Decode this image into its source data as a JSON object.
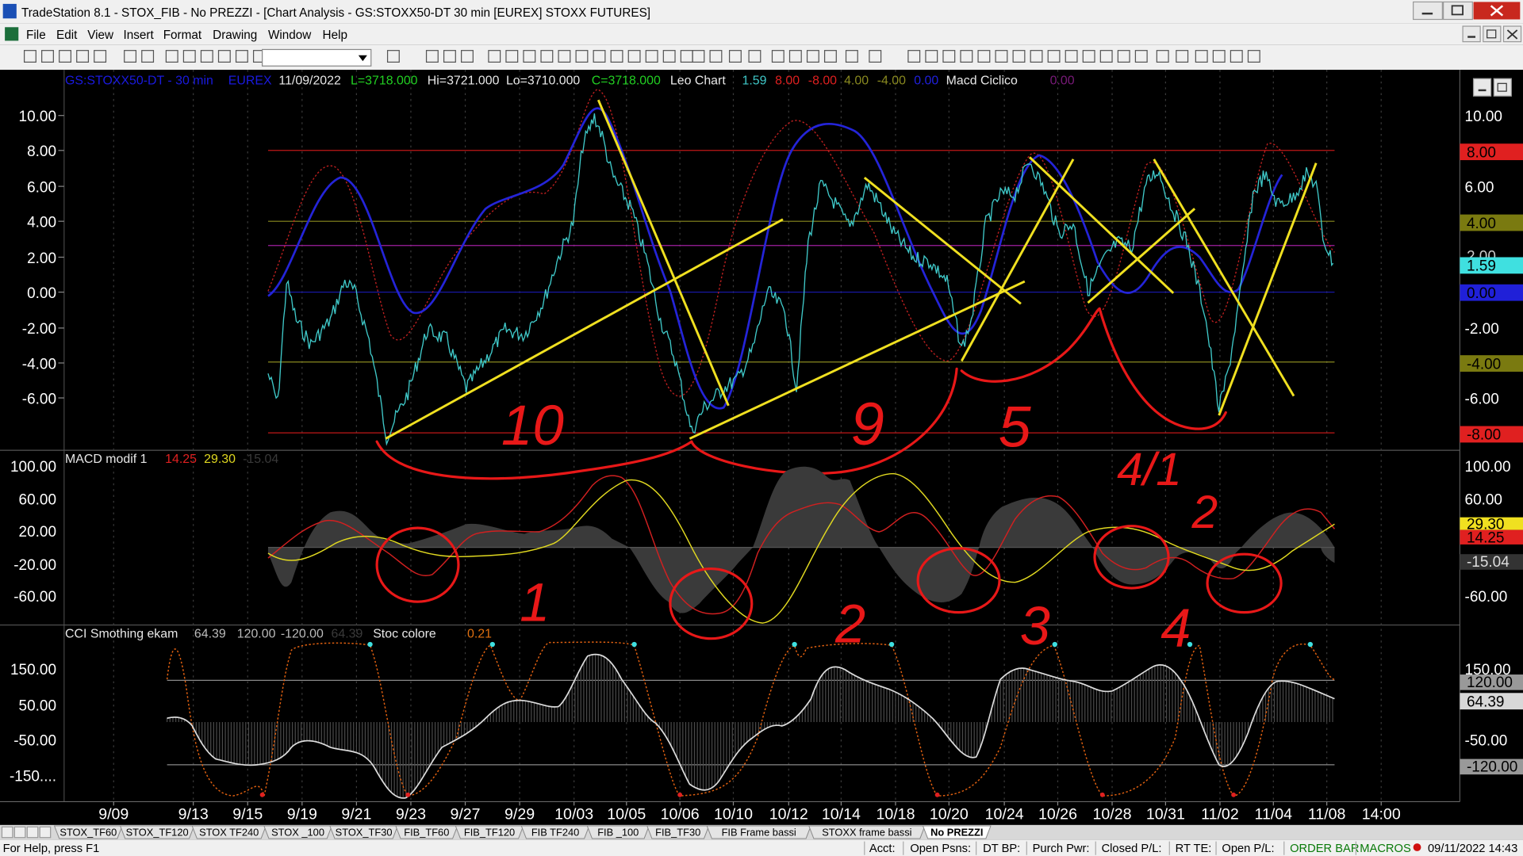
{
  "window": {
    "title": "TradeStation 8.1 - STOX_FIB - No PREZZI - [Chart Analysis - GS:STOXX50-DT  30 min  [EUREX] STOXX FUTURES]",
    "controls": [
      "_",
      "□",
      "×"
    ]
  },
  "menu": [
    "File",
    "Edit",
    "View",
    "Insert",
    "Format",
    "Drawing",
    "Window",
    "Help"
  ],
  "chart": {
    "header": {
      "symbol": "GS:STOXX50-DT - 30 min",
      "exchange": "EUREX",
      "date": "11/09/2022",
      "last": "L=3718.000",
      "high": "Hi=3721.000",
      "low": "Lo=3710.000",
      "close": "C=3718.000",
      "indicator": "Leo Chart",
      "v1": "1.59",
      "v2": "8.00",
      "v3": "-8.00",
      "v4": "4.00",
      "v5": "-4.00",
      "v6": "0.00",
      "indicator2": "Macd Ciclico",
      "v7": "0.00"
    },
    "pane1_ticks": [
      "10.00",
      "8.00",
      "6.00",
      "4.00",
      "2.00",
      "0.00",
      "-2.00",
      "-4.00",
      "-6.00"
    ],
    "pane1_right_ticks": [
      "10.00",
      "6.00",
      "-2.00",
      "-6.00"
    ],
    "pane1_badges": {
      "b8": "8.00",
      "b4": "4.00",
      "b159": "1.59",
      "b0": "0.00",
      "bm4": "-4.00",
      "bm8": "-8.00",
      "b2": "2.00"
    },
    "pane2_header": {
      "name": "MACD modif 1",
      "v1": "14.25",
      "v2": "29.30",
      "v3": "-15.04"
    },
    "pane2_ticks": [
      "100.00",
      "60.00",
      "20.00",
      "-20.00",
      "-60.00"
    ],
    "pane2_right_ticks": [
      "100.00",
      "60.00",
      "-60.00"
    ],
    "pane2_badges": {
      "b2930": "29.30",
      "b1425": "14.25",
      "bm1504": "-15.04"
    },
    "pane3_header": {
      "name": "CCI Smothing ekam",
      "v1": "64.39",
      "v2": "120.00",
      "v3": "-120.00",
      "v4": "64.39",
      "name2": "Stoc colore",
      "v5": "0.21"
    },
    "pane3_ticks": [
      "150.00",
      "50.00",
      "-50.00",
      "-150...."
    ],
    "pane3_right_ticks": [
      "150.00",
      "-50.00"
    ],
    "pane3_badges": {
      "b120": "120.00",
      "b6439": "64.39",
      "bm120": "-120.00"
    },
    "x_axis": [
      "9/09",
      "9/13",
      "9/15",
      "9/19",
      "9/21",
      "9/23",
      "9/27",
      "9/29",
      "10/03",
      "10/05",
      "10/06",
      "10/10",
      "10/12",
      "10/14",
      "10/18",
      "10/20",
      "10/24",
      "10/26",
      "10/28",
      "10/31",
      "11/02",
      "11/04",
      "11/08",
      "14:00"
    ],
    "annotations": [
      "10",
      "9",
      "5",
      "4/1",
      "2",
      "1",
      "2",
      "3",
      "4"
    ]
  },
  "tabs": [
    "STOX_TF60",
    "STOX_TF120",
    "STOX TF240",
    "STOX _100",
    "STOX_TF30",
    "FIB_TF60",
    "FIB_TF120",
    "FIB TF240",
    "FIB _100",
    "FIB_TF30",
    "FIB Frame bassi",
    "STOXX frame bassi",
    "No PREZZI"
  ],
  "status": {
    "help": "For Help, press F1",
    "acct": "Acct:",
    "open_psns": "Open Psns:",
    "dt_bp": "DT BP:",
    "purch_pwr": "Purch Pwr:",
    "closed_pl": "Closed P/L:",
    "rt_te": "RT TE:",
    "open_pl": "Open P/L:",
    "order_bar": "ORDER BAR",
    "macros": "MACROS",
    "datetime": "09/11/2022 14:43"
  },
  "colors": {
    "cyan": "#3fc8c8",
    "blue": "#2020d0",
    "red": "#e02020",
    "yellow": "#f0e020",
    "panel": "#000000"
  }
}
